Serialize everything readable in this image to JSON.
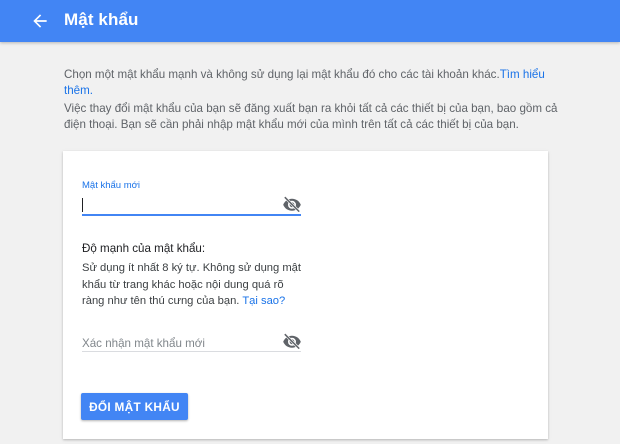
{
  "header": {
    "title": "Mật khẩu",
    "back_icon": "arrow-back-icon"
  },
  "intro": {
    "paragraph1_text": "Chọn một mật khẩu mạnh và không sử dụng lại mật khẩu đó cho các tài khoản khác.",
    "paragraph1_link": "Tìm hiểu thêm.",
    "paragraph2": "Việc thay đổi mật khẩu của bạn sẽ đăng xuất bạn ra khỏi tất cả các thiết bị của bạn, bao gồm cả điện thoại. Bạn sẽ cần phải nhập mật khẩu mới của mình trên tất cả các thiết bị của bạn."
  },
  "form": {
    "new_password_label": "Mật khẩu mới",
    "new_password_value": "",
    "visibility_icon": "eye-off-icon",
    "strength_title": "Độ mạnh của mật khẩu:",
    "strength_description": "Sử dụng ít nhất 8 ký tự. Không sử dụng mật khẩu từ trang khác hoặc nội dung quá rõ ràng như tên thú cưng của bạn.",
    "strength_link": "Tại sao?",
    "confirm_placeholder": "Xác nhận mật khẩu mới",
    "confirm_value": "",
    "submit_label": "ĐỔI MẬT KHẨU"
  },
  "colors": {
    "accent": "#4285f4",
    "link": "#1a73e8",
    "background": "#f1f1f1"
  }
}
